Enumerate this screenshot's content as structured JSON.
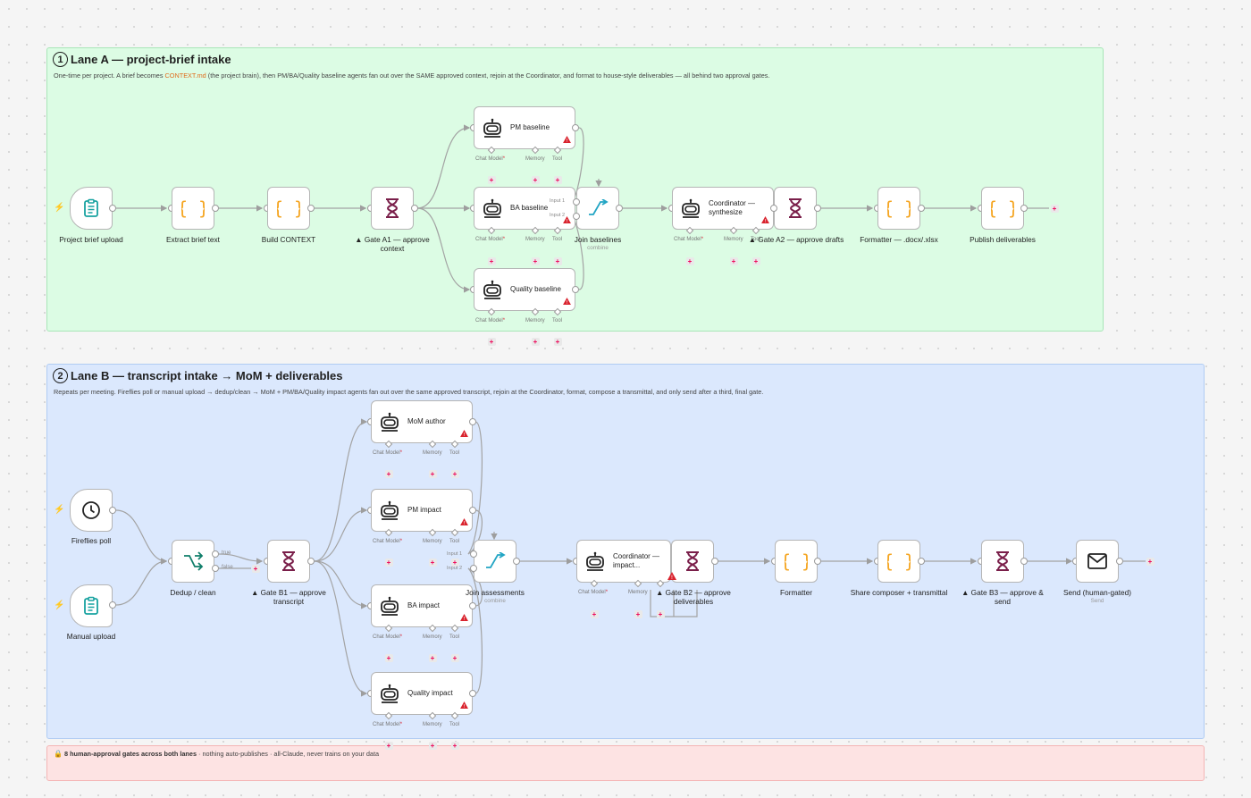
{
  "lane_a": {
    "number": "1",
    "title": "Lane A — project-brief intake",
    "desc_pre": "One-time per project. A brief becomes ",
    "desc_highlight": "CONTEXT.md",
    "desc_post": " (the project brain), then PM/BA/Quality baseline agents fan out over the SAME approved context, rejoin at the Coordinator, and format to house-style deliverables — all behind two approval gates."
  },
  "lane_b": {
    "number": "2",
    "title": "Lane B — transcript intake → MoM + deliverables",
    "desc": "Repeats per meeting. Fireflies poll or manual upload → dedup/clean → MoM + PM/BA/Quality impact agents fan out over the same approved transcript, rejoin at the Coordinator, format, compose a transmittal, and only send after a third, final gate."
  },
  "footer": {
    "icon": "lock-icon",
    "bold": "8 human-approval gates across both lanes",
    "rest": " · nothing auto-publishes · all-Claude, never trains on your data"
  },
  "ports": {
    "chat_model": "Chat Model",
    "required_mark": "*",
    "memory": "Memory",
    "tool": "Tool",
    "input1": "Input 1",
    "input2": "Input 2",
    "true_label": "true",
    "false_label": "false"
  },
  "colors": {
    "lane_a_bg": "#dcfce4",
    "lane_b_bg": "#dbe8fd",
    "lane_c_bg": "#fde3e3",
    "code_icon": "#f5a623",
    "gate_icon": "#7a1f4a",
    "trigger_icon": "#17a2a0",
    "bolt": "#f07a1a",
    "warning": "#d9232e"
  },
  "nodes": [
    {
      "id": "a_upload",
      "label": "Project brief upload",
      "icon": "clipboard-icon",
      "type": "trigger"
    },
    {
      "id": "a_extract",
      "label": "Extract brief text",
      "icon": "braces-icon"
    },
    {
      "id": "a_build",
      "label": "Build CONTEXT",
      "icon": "braces-icon"
    },
    {
      "id": "a_gate1",
      "label": "▲ Gate A1 — approve context",
      "icon": "hourglass-icon"
    },
    {
      "id": "a_pm",
      "label": "PM baseline",
      "icon": "robot-icon",
      "type": "agent"
    },
    {
      "id": "a_ba",
      "label": "BA baseline",
      "icon": "robot-icon",
      "type": "agent"
    },
    {
      "id": "a_qa",
      "label": "Quality baseline",
      "icon": "robot-icon",
      "type": "agent"
    },
    {
      "id": "a_join",
      "label": "Join baselines",
      "sub": "combine",
      "icon": "merge-icon"
    },
    {
      "id": "a_coord",
      "label": "Coordinator — synthesize",
      "icon": "robot-icon",
      "type": "agent"
    },
    {
      "id": "a_gate2",
      "label": "▲ Gate A2 — approve drafts",
      "icon": "hourglass-icon"
    },
    {
      "id": "a_format",
      "label": "Formatter — .docx/.xlsx",
      "icon": "braces-icon"
    },
    {
      "id": "a_publish",
      "label": "Publish deliverables",
      "icon": "braces-icon"
    },
    {
      "id": "b_poll",
      "label": "Fireflies poll",
      "icon": "clock-icon",
      "type": "trigger"
    },
    {
      "id": "b_manual",
      "label": "Manual upload",
      "icon": "clipboard-icon",
      "type": "trigger"
    },
    {
      "id": "b_dedup",
      "label": "Dedup / clean",
      "icon": "branch-icon"
    },
    {
      "id": "b_gate1",
      "label": "▲ Gate B1 — approve transcript",
      "icon": "hourglass-icon"
    },
    {
      "id": "b_mom",
      "label": "MoM author",
      "icon": "robot-icon",
      "type": "agent"
    },
    {
      "id": "b_pm",
      "label": "PM impact",
      "icon": "robot-icon",
      "type": "agent"
    },
    {
      "id": "b_ba",
      "label": "BA impact",
      "icon": "robot-icon",
      "type": "agent"
    },
    {
      "id": "b_qa",
      "label": "Quality impact",
      "icon": "robot-icon",
      "type": "agent"
    },
    {
      "id": "b_join",
      "label": "Join assessments",
      "sub": "combine",
      "icon": "merge-icon"
    },
    {
      "id": "b_coord",
      "label": "Coordinator — impact...",
      "icon": "robot-icon",
      "type": "agent"
    },
    {
      "id": "b_gate2",
      "label": "▲ Gate B2 — approve deliverables",
      "icon": "hourglass-icon"
    },
    {
      "id": "b_format",
      "label": "Formatter",
      "icon": "braces-icon"
    },
    {
      "id": "b_share",
      "label": "Share composer + transmittal",
      "icon": "braces-icon"
    },
    {
      "id": "b_gate3",
      "label": "▲ Gate B3 — approve & send",
      "icon": "hourglass-icon"
    },
    {
      "id": "b_send",
      "label": "Send (human-gated)",
      "sub": "Send",
      "icon": "mail-icon"
    }
  ]
}
